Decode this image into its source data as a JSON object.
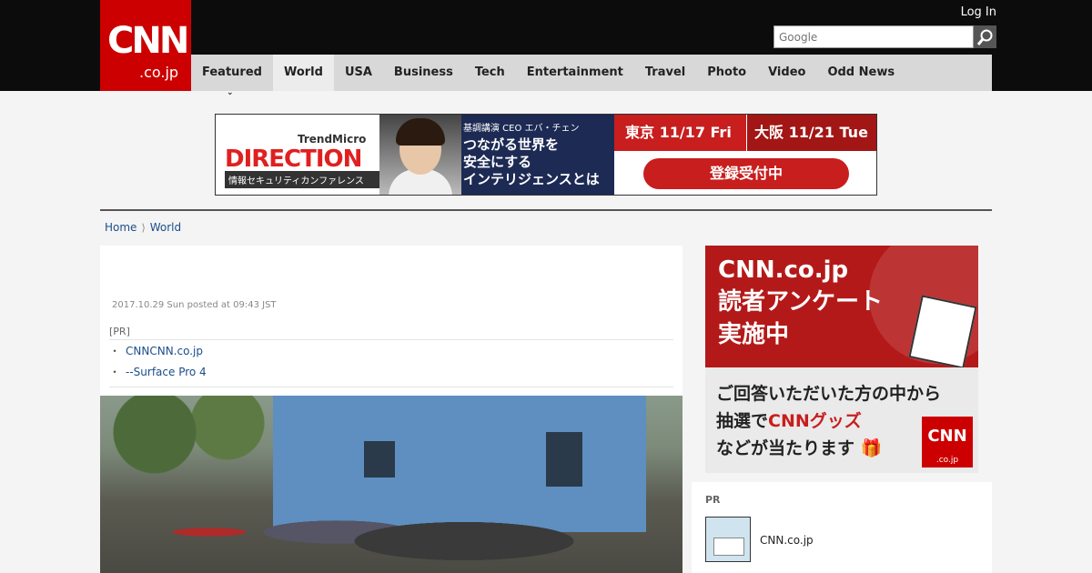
{
  "header": {
    "logo_main": "CNN",
    "logo_sub": ".co.jp",
    "login_label": "Log In",
    "search_placeholder": "Google"
  },
  "nav": {
    "items": [
      "Featured",
      "World",
      "USA",
      "Business",
      "Tech",
      "Entertainment",
      "Travel",
      "Photo",
      "Video",
      "Odd News"
    ],
    "active": "World"
  },
  "ad_banner": {
    "brand": "TrendMicro",
    "title": "DIRECTION",
    "subtitle": "情報セキュリティカンファレンス",
    "speaker": "基調講演 CEO エバ・チェン",
    "headline": "つながる世界を\n安全にする\nインテリジェンスとは",
    "tokyo": "東京 11/17 Fri",
    "osaka": "大阪 11/21 Tue",
    "cta": "登録受付中"
  },
  "breadcrumb": {
    "home": "Home",
    "section": "World"
  },
  "article": {
    "posted": "2017.10.29 Sun posted at 09:43 JST",
    "pr_label": "[PR]",
    "pr_links": [
      "CNNCNN.co.jp",
      "--Surface Pro 4"
    ]
  },
  "sidebar_ad": {
    "line1": "CNN.co.jp",
    "line2": "読者アンケート",
    "line3": "実施中",
    "body1": "ご回答いただいた方の中から",
    "body2_pre": "抽選で",
    "body2_red": "CNNグッズ",
    "body3": "などが当たります",
    "logo_main": "CNN",
    "logo_sub": ".co.jp"
  },
  "pr_box": {
    "label": "PR",
    "title": "CNN.co.jp"
  },
  "colors": {
    "brand_red": "#cc0000",
    "header_bg": "#0c0c0c",
    "nav_bg": "#d8d8d8",
    "link": "#1a4e8a"
  }
}
